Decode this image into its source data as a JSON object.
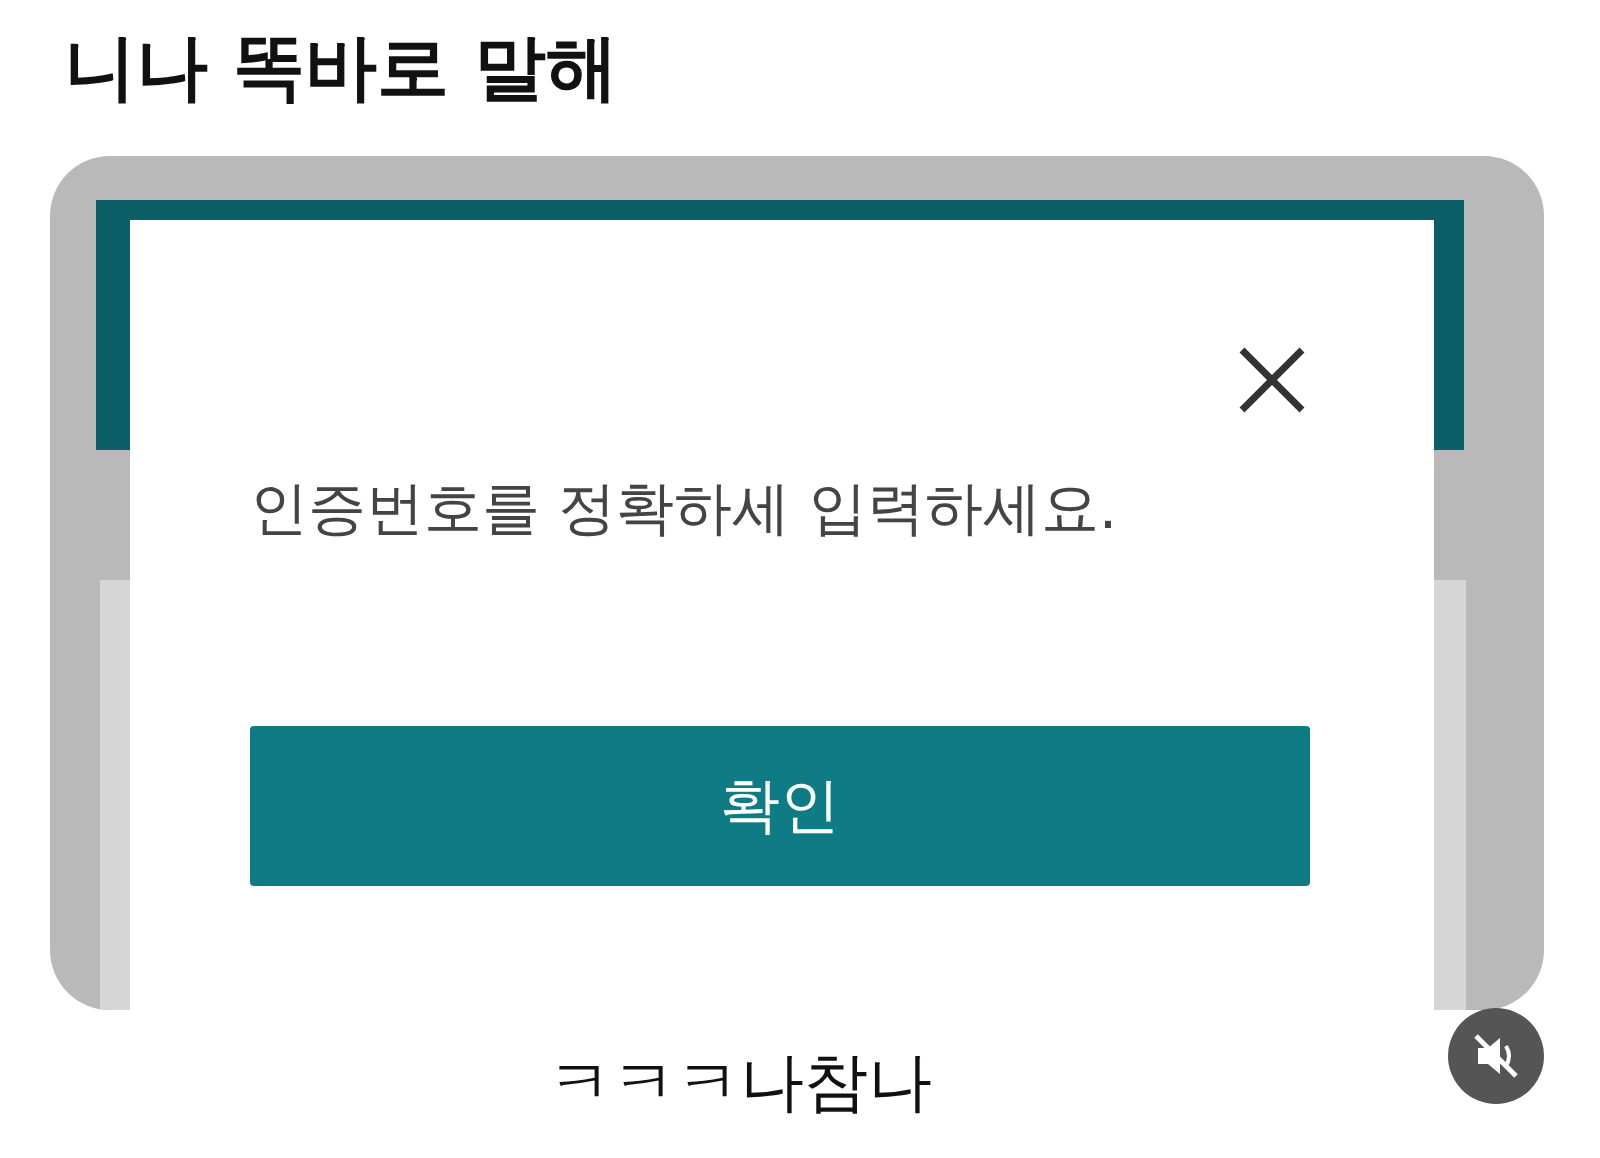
{
  "post": {
    "title": "니나 똑바로 말해",
    "caption": "ㅋㅋㅋ나참나"
  },
  "screenshot": {
    "dialog": {
      "message": "인증번호를 정확하세 입력하세요.",
      "button": "확인"
    }
  }
}
